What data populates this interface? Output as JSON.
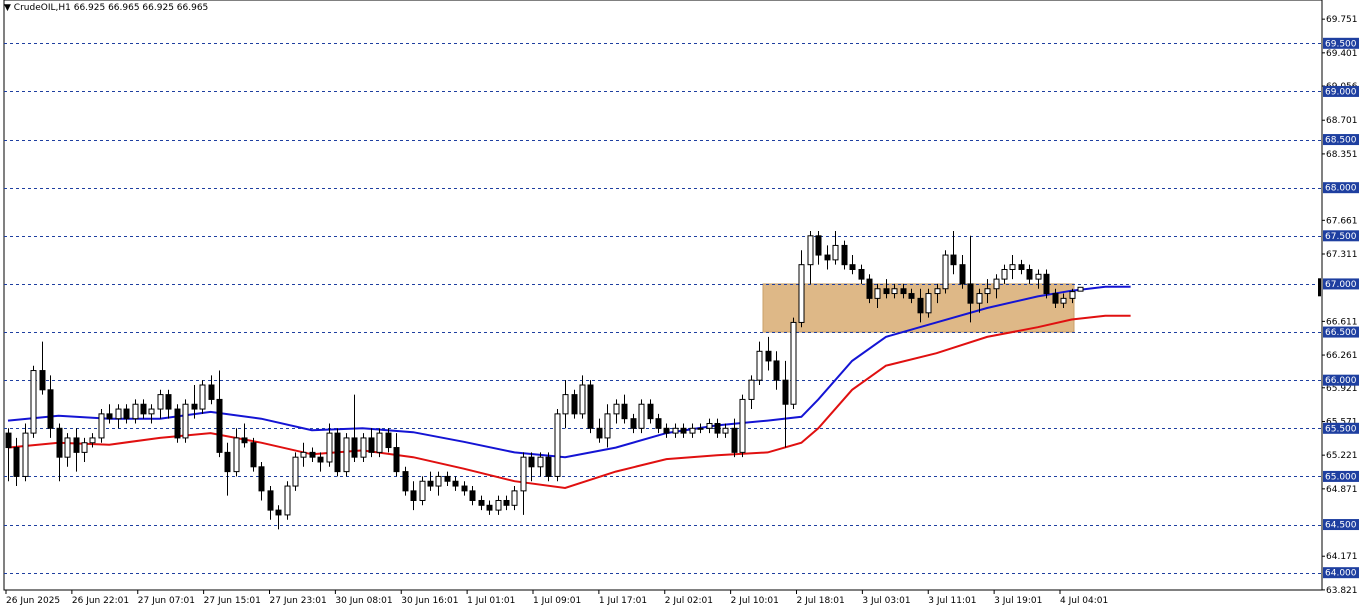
{
  "header": {
    "arrow": "▼",
    "symbol": "CrudeOIL,H1",
    "ohlc": "66.925 66.965 66.925 66.965"
  },
  "colors": {
    "background": "#ffffff",
    "grid": "#1e3fa0",
    "ema_fast": "#1414d4",
    "ema_slow": "#e01010",
    "zone": "#deb887",
    "candle_up": "#ffffff",
    "candle_down": "#000000",
    "label_box": "#1e3fa0",
    "label_text": "#ffffff"
  },
  "chart_data": {
    "type": "candlestick",
    "price_axis_ticks": [
      "69.751",
      "69.401",
      "69.056",
      "68.701",
      "68.351",
      "67.661",
      "67.311",
      "66.611",
      "66.261",
      "65.921",
      "65.571",
      "65.221",
      "64.871",
      "64.171",
      "63.821"
    ],
    "horizontal_levels": [
      "69.500",
      "69.000",
      "68.500",
      "68.000",
      "67.500",
      "67.000",
      "66.500",
      "66.000",
      "65.500",
      "65.000",
      "64.500",
      "64.000"
    ],
    "time_labels": [
      "26 Jun 2025",
      "26 Jun 22:01",
      "27 Jun 07:01",
      "27 Jun 15:01",
      "27 Jun 23:01",
      "30 Jun 08:01",
      "30 Jun 16:01",
      "1 Jul 01:01",
      "1 Jul 09:01",
      "1 Jul 17:01",
      "2 Jul 02:01",
      "2 Jul 10:01",
      "2 Jul 18:01",
      "3 Jul 03:01",
      "3 Jul 11:01",
      "3 Jul 19:01",
      "4 Jul 04:01"
    ],
    "ylim": [
      63.82,
      69.95
    ],
    "zone": {
      "from": 66.5,
      "to": 67.0
    },
    "series": [
      {
        "name": "",
        "type": "ohlc",
        "values": [
          [
            65.45,
            65.5,
            64.95,
            65.3
          ],
          [
            65.3,
            65.4,
            64.9,
            65.0
          ],
          [
            65.0,
            65.55,
            64.95,
            65.45
          ],
          [
            65.45,
            66.15,
            65.4,
            66.1
          ],
          [
            66.1,
            66.4,
            65.85,
            65.9
          ],
          [
            65.9,
            66.05,
            65.4,
            65.5
          ],
          [
            65.5,
            65.55,
            64.95,
            65.2
          ],
          [
            65.2,
            65.45,
            65.1,
            65.4
          ],
          [
            65.4,
            65.5,
            65.05,
            65.25
          ],
          [
            65.25,
            65.4,
            65.15,
            65.35
          ],
          [
            65.35,
            65.45,
            65.3,
            65.4
          ],
          [
            65.4,
            65.7,
            65.35,
            65.65
          ],
          [
            65.65,
            65.75,
            65.55,
            65.6
          ],
          [
            65.6,
            65.75,
            65.5,
            65.7
          ],
          [
            65.7,
            65.75,
            65.55,
            65.6
          ],
          [
            65.6,
            65.8,
            65.55,
            65.75
          ],
          [
            65.75,
            65.8,
            65.6,
            65.65
          ],
          [
            65.65,
            65.75,
            65.55,
            65.7
          ],
          [
            65.7,
            65.9,
            65.6,
            65.85
          ],
          [
            65.85,
            65.9,
            65.6,
            65.7
          ],
          [
            65.7,
            65.75,
            65.35,
            65.4
          ],
          [
            65.4,
            65.8,
            65.35,
            65.75
          ],
          [
            65.75,
            65.95,
            65.6,
            65.7
          ],
          [
            65.7,
            66.0,
            65.65,
            65.95
          ],
          [
            65.95,
            66.05,
            65.75,
            65.8
          ],
          [
            65.8,
            66.1,
            65.2,
            65.25
          ],
          [
            65.25,
            65.35,
            64.8,
            65.05
          ],
          [
            65.05,
            65.5,
            65.0,
            65.4
          ],
          [
            65.4,
            65.55,
            65.3,
            65.35
          ],
          [
            65.35,
            65.4,
            65.05,
            65.1
          ],
          [
            65.1,
            65.15,
            64.75,
            64.85
          ],
          [
            64.85,
            64.9,
            64.55,
            64.65
          ],
          [
            64.65,
            64.7,
            64.45,
            64.6
          ],
          [
            64.6,
            64.95,
            64.55,
            64.9
          ],
          [
            64.9,
            65.25,
            64.85,
            65.2
          ],
          [
            65.2,
            65.35,
            65.1,
            65.25
          ],
          [
            65.25,
            65.3,
            65.15,
            65.2
          ],
          [
            65.2,
            65.25,
            65.05,
            65.15
          ],
          [
            65.15,
            65.55,
            65.1,
            65.45
          ],
          [
            65.45,
            65.5,
            65.0,
            65.05
          ],
          [
            65.05,
            65.45,
            65.0,
            65.4
          ],
          [
            65.4,
            65.85,
            65.15,
            65.2
          ],
          [
            65.2,
            65.45,
            65.15,
            65.4
          ],
          [
            65.4,
            65.5,
            65.2,
            65.25
          ],
          [
            65.25,
            65.5,
            65.2,
            65.45
          ],
          [
            65.45,
            65.5,
            65.25,
            65.3
          ],
          [
            65.3,
            65.45,
            65.0,
            65.05
          ],
          [
            65.05,
            65.1,
            64.8,
            64.85
          ],
          [
            64.85,
            64.95,
            64.65,
            64.75
          ],
          [
            64.75,
            65.0,
            64.7,
            64.95
          ],
          [
            64.95,
            65.05,
            64.85,
            64.9
          ],
          [
            64.9,
            65.05,
            64.8,
            65.0
          ],
          [
            65.0,
            65.05,
            64.9,
            64.95
          ],
          [
            64.95,
            65.0,
            64.85,
            64.9
          ],
          [
            64.9,
            64.95,
            64.8,
            64.85
          ],
          [
            64.85,
            64.9,
            64.7,
            64.75
          ],
          [
            64.75,
            64.8,
            64.65,
            64.7
          ],
          [
            64.7,
            64.75,
            64.6,
            64.65
          ],
          [
            64.65,
            64.8,
            64.6,
            64.75
          ],
          [
            64.75,
            64.8,
            64.65,
            64.7
          ],
          [
            64.7,
            64.9,
            64.65,
            64.85
          ],
          [
            64.85,
            65.25,
            64.6,
            65.2
          ],
          [
            65.2,
            65.25,
            64.95,
            65.1
          ],
          [
            65.1,
            65.25,
            65.0,
            65.2
          ],
          [
            65.2,
            65.25,
            64.95,
            65.0
          ],
          [
            65.0,
            65.7,
            64.95,
            65.65
          ],
          [
            65.65,
            66.0,
            65.5,
            65.85
          ],
          [
            65.85,
            65.9,
            65.6,
            65.65
          ],
          [
            65.65,
            66.05,
            65.6,
            65.95
          ],
          [
            65.95,
            66.0,
            65.45,
            65.5
          ],
          [
            65.5,
            65.6,
            65.35,
            65.4
          ],
          [
            65.4,
            65.75,
            65.3,
            65.65
          ],
          [
            65.65,
            65.8,
            65.55,
            65.75
          ],
          [
            65.75,
            65.85,
            65.55,
            65.6
          ],
          [
            65.6,
            65.65,
            65.45,
            65.5
          ],
          [
            65.5,
            65.8,
            65.45,
            65.75
          ],
          [
            65.75,
            65.8,
            65.55,
            65.6
          ],
          [
            65.6,
            65.65,
            65.45,
            65.5
          ],
          [
            65.5,
            65.55,
            65.4,
            65.45
          ],
          [
            65.45,
            65.55,
            65.4,
            65.5
          ],
          [
            65.5,
            65.55,
            65.4,
            65.45
          ],
          [
            65.45,
            65.55,
            65.4,
            65.5
          ],
          [
            65.5,
            65.55,
            65.45,
            65.5
          ],
          [
            65.5,
            65.6,
            65.45,
            65.55
          ],
          [
            65.55,
            65.6,
            65.4,
            65.45
          ],
          [
            65.45,
            65.55,
            65.4,
            65.5
          ],
          [
            65.5,
            65.6,
            65.2,
            65.25
          ],
          [
            65.25,
            65.85,
            65.2,
            65.8
          ],
          [
            65.8,
            66.05,
            65.7,
            66.0
          ],
          [
            66.0,
            66.4,
            65.95,
            66.3
          ],
          [
            66.3,
            66.45,
            66.1,
            66.2
          ],
          [
            66.2,
            66.3,
            65.9,
            66.0
          ],
          [
            66.0,
            66.2,
            65.3,
            65.75
          ],
          [
            65.75,
            66.65,
            65.7,
            66.6
          ],
          [
            66.6,
            67.35,
            66.55,
            67.2
          ],
          [
            67.2,
            67.55,
            67.0,
            67.5
          ],
          [
            67.5,
            67.55,
            67.2,
            67.3
          ],
          [
            67.3,
            67.4,
            67.15,
            67.25
          ],
          [
            67.25,
            67.55,
            67.2,
            67.4
          ],
          [
            67.4,
            67.45,
            67.15,
            67.2
          ],
          [
            67.2,
            67.3,
            67.1,
            67.15
          ],
          [
            67.15,
            67.2,
            67.0,
            67.05
          ],
          [
            67.05,
            67.1,
            66.8,
            66.85
          ],
          [
            66.85,
            67.0,
            66.75,
            66.95
          ],
          [
            66.95,
            67.05,
            66.85,
            66.9
          ],
          [
            66.9,
            67.0,
            66.85,
            66.95
          ],
          [
            66.95,
            67.0,
            66.85,
            66.9
          ],
          [
            66.9,
            66.95,
            66.8,
            66.85
          ],
          [
            66.85,
            66.95,
            66.6,
            66.7
          ],
          [
            66.7,
            66.95,
            66.65,
            66.9
          ],
          [
            66.9,
            67.0,
            66.8,
            66.95
          ],
          [
            66.95,
            67.35,
            66.9,
            67.3
          ],
          [
            67.3,
            67.55,
            67.1,
            67.2
          ],
          [
            67.2,
            67.3,
            66.95,
            67.0
          ],
          [
            67.0,
            67.5,
            66.6,
            66.8
          ],
          [
            66.8,
            66.95,
            66.7,
            66.9
          ],
          [
            66.9,
            67.05,
            66.8,
            66.95
          ],
          [
            66.95,
            67.1,
            66.85,
            67.05
          ],
          [
            67.05,
            67.2,
            67.0,
            67.15
          ],
          [
            67.15,
            67.3,
            67.05,
            67.2
          ],
          [
            67.2,
            67.25,
            67.1,
            67.15
          ],
          [
            67.15,
            67.2,
            67.0,
            67.05
          ],
          [
            67.05,
            67.15,
            66.95,
            67.1
          ],
          [
            67.1,
            67.15,
            66.85,
            66.9
          ],
          [
            66.9,
            66.95,
            66.75,
            66.8
          ],
          [
            66.8,
            66.9,
            66.75,
            66.85
          ],
          [
            66.85,
            66.95,
            66.8,
            66.92
          ],
          [
            66.925,
            66.965,
            66.925,
            66.965
          ]
        ]
      },
      {
        "name": "",
        "type": "line",
        "role": "ema_fast",
        "values": [
          [
            0,
            65.58
          ],
          [
            6,
            65.63
          ],
          [
            12,
            65.6
          ],
          [
            18,
            65.6
          ],
          [
            24,
            65.67
          ],
          [
            30,
            65.6
          ],
          [
            36,
            65.48
          ],
          [
            42,
            65.5
          ],
          [
            48,
            65.46
          ],
          [
            54,
            65.36
          ],
          [
            60,
            65.25
          ],
          [
            66,
            65.2
          ],
          [
            72,
            65.3
          ],
          [
            78,
            65.45
          ],
          [
            84,
            65.53
          ],
          [
            90,
            65.58
          ],
          [
            94,
            65.62
          ],
          [
            96,
            65.8
          ],
          [
            100,
            66.2
          ],
          [
            104,
            66.45
          ],
          [
            110,
            66.6
          ],
          [
            116,
            66.75
          ],
          [
            122,
            66.87
          ],
          [
            126,
            66.93
          ],
          [
            130,
            66.97
          ],
          [
            133,
            66.97
          ]
        ]
      },
      {
        "name": "",
        "type": "line",
        "role": "ema_slow",
        "values": [
          [
            0,
            65.3
          ],
          [
            6,
            65.35
          ],
          [
            12,
            65.33
          ],
          [
            18,
            65.4
          ],
          [
            24,
            65.45
          ],
          [
            30,
            65.35
          ],
          [
            36,
            65.23
          ],
          [
            42,
            65.27
          ],
          [
            48,
            65.2
          ],
          [
            54,
            65.08
          ],
          [
            60,
            64.95
          ],
          [
            66,
            64.88
          ],
          [
            72,
            65.05
          ],
          [
            78,
            65.18
          ],
          [
            84,
            65.22
          ],
          [
            90,
            65.25
          ],
          [
            94,
            65.35
          ],
          [
            96,
            65.5
          ],
          [
            100,
            65.9
          ],
          [
            104,
            66.15
          ],
          [
            110,
            66.28
          ],
          [
            116,
            66.45
          ],
          [
            122,
            66.55
          ],
          [
            126,
            66.63
          ],
          [
            130,
            66.67
          ],
          [
            133,
            66.67
          ]
        ]
      }
    ]
  }
}
